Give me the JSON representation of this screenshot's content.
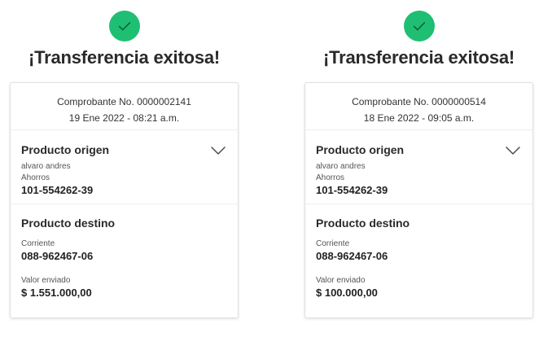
{
  "colors": {
    "success": "#1fbf73"
  },
  "panels": [
    {
      "title": "¡Transferencia exitosa!",
      "receipt_line": "Comprobante No. 0000002141",
      "date_line": "19 Ene 2022 - 08:21 a.m.",
      "origin": {
        "heading": "Producto origen",
        "owner": "alvaro andres",
        "account_type": "Ahorros",
        "account_number": "101-554262-39"
      },
      "destination": {
        "heading": "Producto destino",
        "account_type": "Corriente",
        "account_number": "088-962467-06",
        "amount_label": "Valor enviado",
        "amount": "$ 1.551.000,00"
      }
    },
    {
      "title": "¡Transferencia exitosa!",
      "receipt_line": "Comprobante No. 0000000514",
      "date_line": "18 Ene 2022 - 09:05 a.m.",
      "origin": {
        "heading": "Producto origen",
        "owner": "alvaro andres",
        "account_type": "Ahorros",
        "account_number": "101-554262-39"
      },
      "destination": {
        "heading": "Producto destino",
        "account_type": "Corriente",
        "account_number": "088-962467-06",
        "amount_label": "Valor enviado",
        "amount": "$ 100.000,00"
      }
    }
  ]
}
